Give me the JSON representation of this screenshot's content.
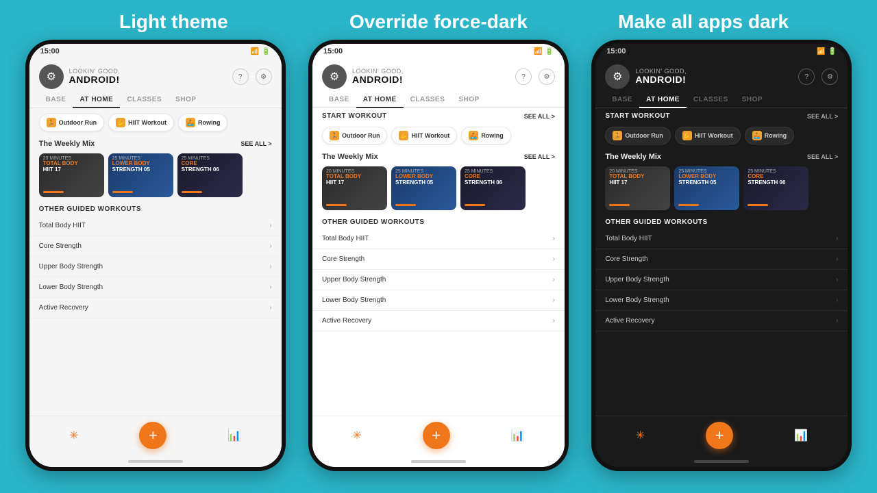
{
  "page": {
    "background": "#2ab5c8",
    "titles": [
      "Light theme",
      "Override force-dark",
      "Make all apps dark"
    ]
  },
  "phone_common": {
    "status_time": "15:00",
    "greeting_small": "LOOKIN' GOOD,",
    "greeting_big": "ANDROID!",
    "nav_tabs": [
      "BASE",
      "AT HOME",
      "CLASSES",
      "SHOP"
    ],
    "active_tab": "AT HOME",
    "quick_buttons": [
      "Outdoor Run",
      "HIIT Workout",
      "Rowing"
    ],
    "weekly_mix_label": "The Weekly Mix",
    "see_all": "SEE ALL",
    "cards": [
      {
        "minutes": "20 MINUTES",
        "title_line1": "TOTAL BODY",
        "title_line2": "HIIT 17",
        "accent": "TOTAL BODY"
      },
      {
        "minutes": "25 MINUTES",
        "title_line1": "LOWER BODY",
        "title_line2": "STRENGTH 05",
        "accent": "LOWER BODY"
      },
      {
        "minutes": "25 MINUTES",
        "title_line1": "CORE",
        "title_line2": "STRENGTH 06",
        "accent": "CORE"
      }
    ],
    "other_workouts_label": "OTHER GUIDED WORKOUTS",
    "workout_items": [
      "Total Body HIIT",
      "Core Strength",
      "Upper Body Strength",
      "Lower Body Strength",
      "Active Recovery"
    ],
    "start_workout_label": "START WORKOUT",
    "add_btn_label": "+"
  }
}
